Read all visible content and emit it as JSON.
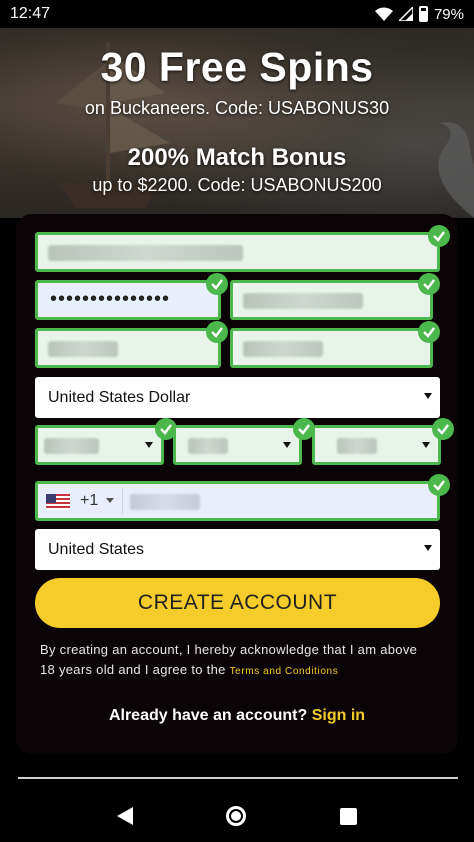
{
  "status_bar": {
    "time": "12:47",
    "battery": "79%",
    "icons": [
      "wifi-icon",
      "signal-icon",
      "battery-icon"
    ]
  },
  "hero": {
    "title": "30 Free Spins",
    "title_sub": "on Buckaneers. Code: USABONUS30",
    "bonus": "200% Match Bonus",
    "bonus_sub": "up to $2200. Code: USABONUS200"
  },
  "form": {
    "password_mask": "•••••••••••••••",
    "currency_select": "United States Dollar",
    "phone_code": "+1",
    "country_select": "United States",
    "create_button": "CREATE ACCOUNT",
    "legal_text": "By creating an account, I hereby acknowledge that I am above 18 years old and I agree to the",
    "legal_link": "Terms and Conditions"
  },
  "signin": {
    "prompt": "Already have an account?",
    "link": "Sign in"
  },
  "colors": {
    "accent": "#f5cc2a",
    "valid": "#4cb84c"
  }
}
